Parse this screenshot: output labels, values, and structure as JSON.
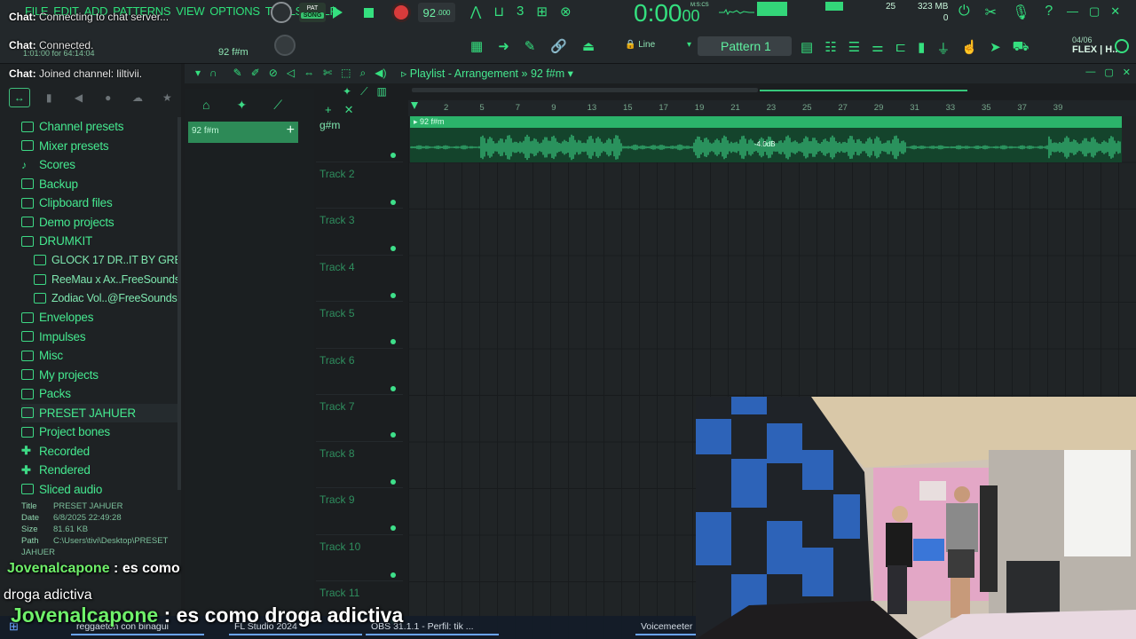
{
  "menu": [
    "FILE",
    "EDIT",
    "ADD",
    "PATTERNS",
    "VIEW",
    "OPTIONS",
    "TOOLS",
    "HELP"
  ],
  "chat_status": {
    "label": "Chat:",
    "line1": "Connecting to chat server...",
    "line2": "Connected.",
    "line3": "Joined channel: liltivii."
  },
  "hint": "1:01:00 for 64:14:04",
  "transport": {
    "mode_pat": "PAT",
    "mode_song": "SONG",
    "tempo": "92",
    "tempo_frac": ".000"
  },
  "time_display": {
    "main": "0:00",
    "sub": "00",
    "label": "M:S:CS"
  },
  "cpu": "25",
  "memory": {
    "ram": "323 MB",
    "polyphony": "0"
  },
  "song_pos_label": "92 f#m",
  "snap_label": "Line",
  "pattern_selector": "Pattern 1",
  "flex": {
    "date": "04/06",
    "name": "FLEX | H..."
  },
  "browser": {
    "items": [
      {
        "label": "Channel presets",
        "icon": "folder-icon",
        "sub": false
      },
      {
        "label": "Mixer presets",
        "icon": "folder-icon",
        "sub": false
      },
      {
        "label": "Scores",
        "icon": "note-icon",
        "sub": false
      },
      {
        "label": "Backup",
        "icon": "folder-icon",
        "sub": false
      },
      {
        "label": "Clipboard files",
        "icon": "folder-icon",
        "sub": false
      },
      {
        "label": "Demo projects",
        "icon": "folder-icon",
        "sub": false
      },
      {
        "label": "DRUMKIT",
        "icon": "folder-icon",
        "sub": false
      },
      {
        "label": "GLOCK 17 DR..IT BY GREDY",
        "icon": "folder-icon",
        "sub": true
      },
      {
        "label": "ReeMau x Ax..FreeSounds1",
        "icon": "folder-icon",
        "sub": true
      },
      {
        "label": "Zodiac Vol..@FreeSounds1",
        "icon": "folder-icon",
        "sub": true
      },
      {
        "label": "Envelopes",
        "icon": "folder-icon",
        "sub": false
      },
      {
        "label": "Impulses",
        "icon": "folder-icon",
        "sub": false
      },
      {
        "label": "Misc",
        "icon": "folder-icon",
        "sub": false
      },
      {
        "label": "My projects",
        "icon": "folder-icon",
        "sub": false
      },
      {
        "label": "Packs",
        "icon": "folder-icon",
        "sub": false
      },
      {
        "label": "PRESET JAHUER",
        "icon": "folder-icon",
        "sub": false,
        "highlighted": true
      },
      {
        "label": "Project bones",
        "icon": "folder-icon",
        "sub": false
      },
      {
        "label": "Recorded",
        "icon": "plus-icon",
        "sub": false
      },
      {
        "label": "Rendered",
        "icon": "plus-icon",
        "sub": false
      },
      {
        "label": "Sliced audio",
        "icon": "folder-icon",
        "sub": false
      }
    ],
    "info": {
      "title_key": "Title",
      "title": "PRESET JAHUER",
      "date_key": "Date",
      "date": "6/8/2025 22:49:28",
      "size_key": "Size",
      "size": "81.61 KB",
      "path_key": "Path",
      "path": "C:\\Users\\tivi\\Desktop\\PRESET JAHUER"
    }
  },
  "channel_pattern": "92 f#m",
  "playlist": {
    "title": "Playlist - Arrangement",
    "title_sep": "»",
    "pattern": "92 f#m",
    "first_track_name": "g#m",
    "tracks": [
      "Track 2",
      "Track 3",
      "Track 4",
      "Track 5",
      "Track 6",
      "Track 7",
      "Track 8",
      "Track 9",
      "Track 10",
      "Track 11"
    ],
    "ruler": [
      "2",
      "5",
      "7",
      "9",
      "13",
      "15",
      "17",
      "19",
      "21",
      "23",
      "25",
      "27",
      "29",
      "31",
      "33",
      "35",
      "37",
      "39"
    ],
    "clip_name": "92 f#m",
    "cursor_readout": "-4.0dB"
  },
  "chat_messages": [
    {
      "user": "Jovenalcapone",
      "text": " : es como",
      "text2": "droga adictiva"
    },
    {
      "user": "Jovenalcapone",
      "text": " : es como droga adictiva"
    }
  ],
  "taskbar": [
    {
      "label": "reggaeton con binagui"
    },
    {
      "label": "FL Studio 2024"
    },
    {
      "label": "OBS 31.1.1 - Perfil: tik ..."
    },
    {
      "label": "Voicemeeter"
    }
  ],
  "colors": {
    "accent": "#35e07f",
    "clip_header": "#2bb36a",
    "clip_body": "#14442c",
    "record": "#d93b3b"
  }
}
